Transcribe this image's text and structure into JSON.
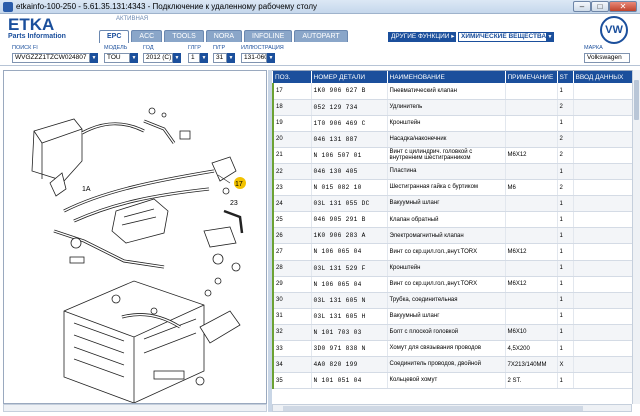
{
  "window": {
    "title": "etkainfo-100-250 - 5.61.35.131:4343 - Подключение к удаленному рабочему столу",
    "min_glyph": "–",
    "max_glyph": "□",
    "close_glyph": "✕"
  },
  "app": {
    "logo_text": "ETKA",
    "logo_sub": "Parts Information",
    "header_hint": "АКТИВНАЯ",
    "tabs": [
      {
        "label": "EPC",
        "active": true
      },
      {
        "label": "ACC",
        "active": false
      },
      {
        "label": "TOOLS",
        "active": false
      },
      {
        "label": "NORA",
        "active": false
      },
      {
        "label": "INFOLINE",
        "active": false
      },
      {
        "label": "AUTOPART",
        "active": false
      }
    ],
    "functions_button": "ДРУГИЕ ФУНКЦИИ ▸",
    "chemicals_button": "ХИМИЧЕСКИЕ ВЕЩЕСТВА",
    "brand_logo": "VW"
  },
  "filters": {
    "vin_label": "ПОИСК FI",
    "vin_value": "WVGZZZ1TZCW024807",
    "model_label": "МОДЕЛЬ",
    "model_value": "TOU",
    "year_label": "ГОД",
    "year_value": "2012 (C)",
    "group_label": "ГЛГР",
    "group_value": "1",
    "subgroup_label": "П/ГР",
    "subgroup_value": "31",
    "illustration_label": "ИЛЛЮСТРАЦИЯ",
    "illustration_value": "131-060",
    "brand_label": "МАРКА",
    "brand_value": "Volkswagen"
  },
  "diagram": {
    "callouts": [
      "17",
      "1A",
      "23"
    ],
    "highlight_color": "#f2c200"
  },
  "table": {
    "headers": [
      "ПОЗ.",
      "НОМЕР ДЕТАЛИ",
      "НАИМЕНОВАНИЕ",
      "ПРИМЕЧАНИЕ",
      "ST",
      "ВВОД ДАННЫХ"
    ],
    "rows": [
      {
        "pos": "17",
        "num": "1K0 906 627 B",
        "name": "Пневматический клапан",
        "note": "",
        "st": "1"
      },
      {
        "pos": "18",
        "num": "052 129 734",
        "name": "Удлинитель",
        "note": "",
        "st": "2"
      },
      {
        "pos": "19",
        "num": "1T0 906 469 C",
        "name": "Кронштейн",
        "note": "",
        "st": "1"
      },
      {
        "pos": "20",
        "num": "046 131 887",
        "name": "Насадка/наконечник",
        "note": "",
        "st": "2"
      },
      {
        "pos": "21",
        "num": "N  106 507 01",
        "name": "Винт с цилиндрич. головкой с внутренним шестигранником",
        "note": "M6X12",
        "st": "2"
      },
      {
        "pos": "22",
        "num": "046 130 405",
        "name": "Пластина",
        "note": "",
        "st": "1"
      },
      {
        "pos": "23",
        "num": "N  015 082 10",
        "name": "Шестигранная гайка с буртиком",
        "note": "M6",
        "st": "2"
      },
      {
        "pos": "24",
        "num": "03L 131 055 DC",
        "name": "Вакуумный шланг",
        "note": "",
        "st": "1"
      },
      {
        "pos": "25",
        "num": "046 905 291 B",
        "name": "Клапан обратный",
        "note": "",
        "st": "1"
      },
      {
        "pos": "26",
        "num": "1K0 906 283 A",
        "name": "Электромагнитный клапан",
        "note": "",
        "st": "1"
      },
      {
        "pos": "27",
        "num": "N  106 065 04",
        "name": "Винт со скр.цил.гол.,внут.TORX",
        "note": "M6X12",
        "st": "1"
      },
      {
        "pos": "28",
        "num": "03L 131 529 F",
        "name": "Кронштейн",
        "note": "",
        "st": "1"
      },
      {
        "pos": "29",
        "num": "N  106 065 04",
        "name": "Винт со скр.цил.гол.,внут.TORX",
        "note": "M6X12",
        "st": "1"
      },
      {
        "pos": "30",
        "num": "03L 131 605 N",
        "name": "Трубка, соединительная",
        "note": "",
        "st": "1"
      },
      {
        "pos": "31",
        "num": "03L 131 605 H",
        "name": "Вакуумный шланг",
        "note": "",
        "st": "1"
      },
      {
        "pos": "32",
        "num": "N  101 703 03",
        "name": "Болт с плоской головкой",
        "note": "M6X10",
        "st": "1"
      },
      {
        "pos": "33",
        "num": "3D0 971 838 N",
        "name": "Хомут для связывания проводов",
        "note": "4,5X200",
        "st": "1"
      },
      {
        "pos": "34",
        "num": "4A0 820 199",
        "name": "Соединитель проводов, двойной",
        "note": "7X213/140MM",
        "st": "X"
      },
      {
        "pos": "35",
        "num": "N  101 051 04",
        "name": "Кольцевой хомут",
        "note": "2 ST.",
        "st": "1"
      }
    ]
  }
}
